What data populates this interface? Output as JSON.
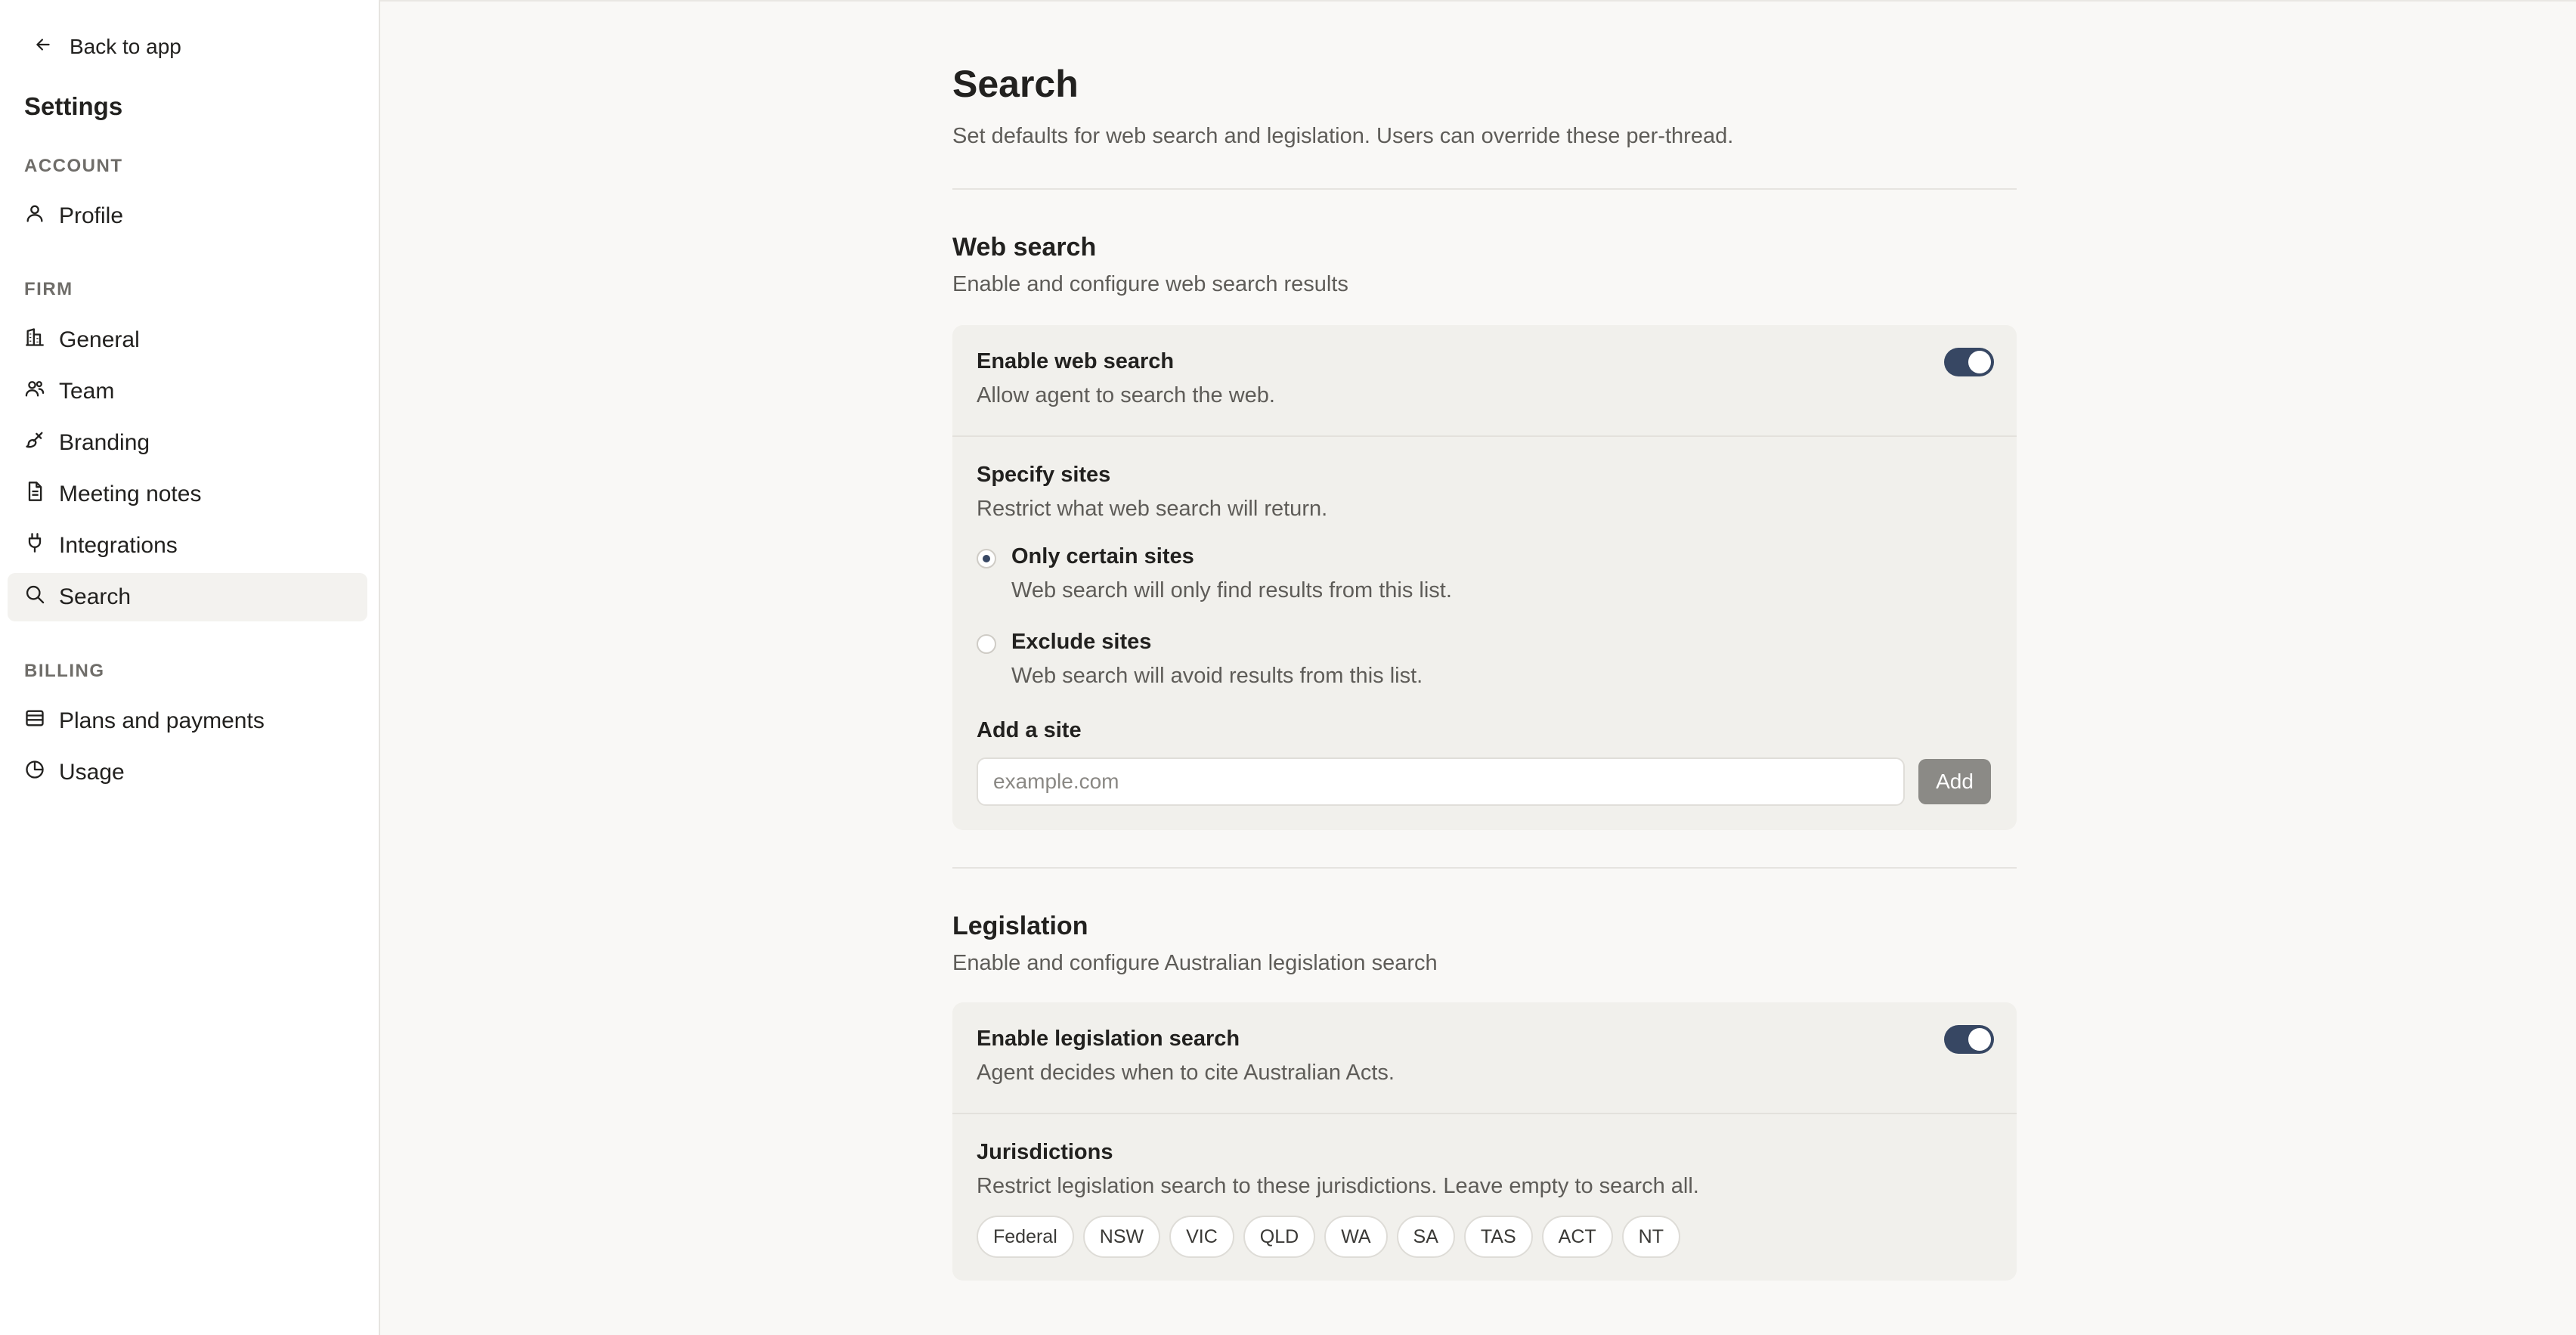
{
  "sidebar": {
    "back_label": "Back to app",
    "title": "Settings",
    "sections": {
      "account": "ACCOUNT",
      "firm": "FIRM",
      "billing": "BILLING"
    },
    "items": {
      "profile": "Profile",
      "general": "General",
      "team": "Team",
      "branding": "Branding",
      "meeting_notes": "Meeting notes",
      "integrations": "Integrations",
      "search": "Search",
      "plans": "Plans and payments",
      "usage": "Usage"
    },
    "active_item": "Search"
  },
  "page": {
    "title": "Search",
    "subtitle": "Set defaults for web search and legislation. Users can override these per-thread."
  },
  "web_search": {
    "title": "Web search",
    "description": "Enable and configure web search results",
    "enable": {
      "title": "Enable web search",
      "description": "Allow agent to search the web.",
      "enabled": true
    },
    "specify_sites": {
      "title": "Specify sites",
      "description": "Restrict what web search will return.",
      "options": [
        {
          "label": "Only certain sites",
          "description": "Web search will only find results from this list.",
          "checked": true
        },
        {
          "label": "Exclude sites",
          "description": "Web search will avoid results from this list.",
          "checked": false
        }
      ]
    },
    "add_site": {
      "label": "Add a site",
      "placeholder": "example.com",
      "value": "",
      "button_label": "Add"
    }
  },
  "legislation": {
    "title": "Legislation",
    "description": "Enable and configure Australian legislation search",
    "enable": {
      "title": "Enable legislation search",
      "description": "Agent decides when to cite Australian Acts.",
      "enabled": true
    },
    "jurisdictions": {
      "title": "Jurisdictions",
      "description": "Restrict legislation search to these jurisdictions. Leave empty to search all.",
      "chips": [
        "Federal",
        "NSW",
        "VIC",
        "QLD",
        "WA",
        "SA",
        "TAS",
        "ACT",
        "NT"
      ]
    }
  },
  "colors": {
    "accent": "#374763",
    "background": "#f9f8f6",
    "card": "#f1f0ec",
    "button_disabled": "#8b8a86"
  }
}
